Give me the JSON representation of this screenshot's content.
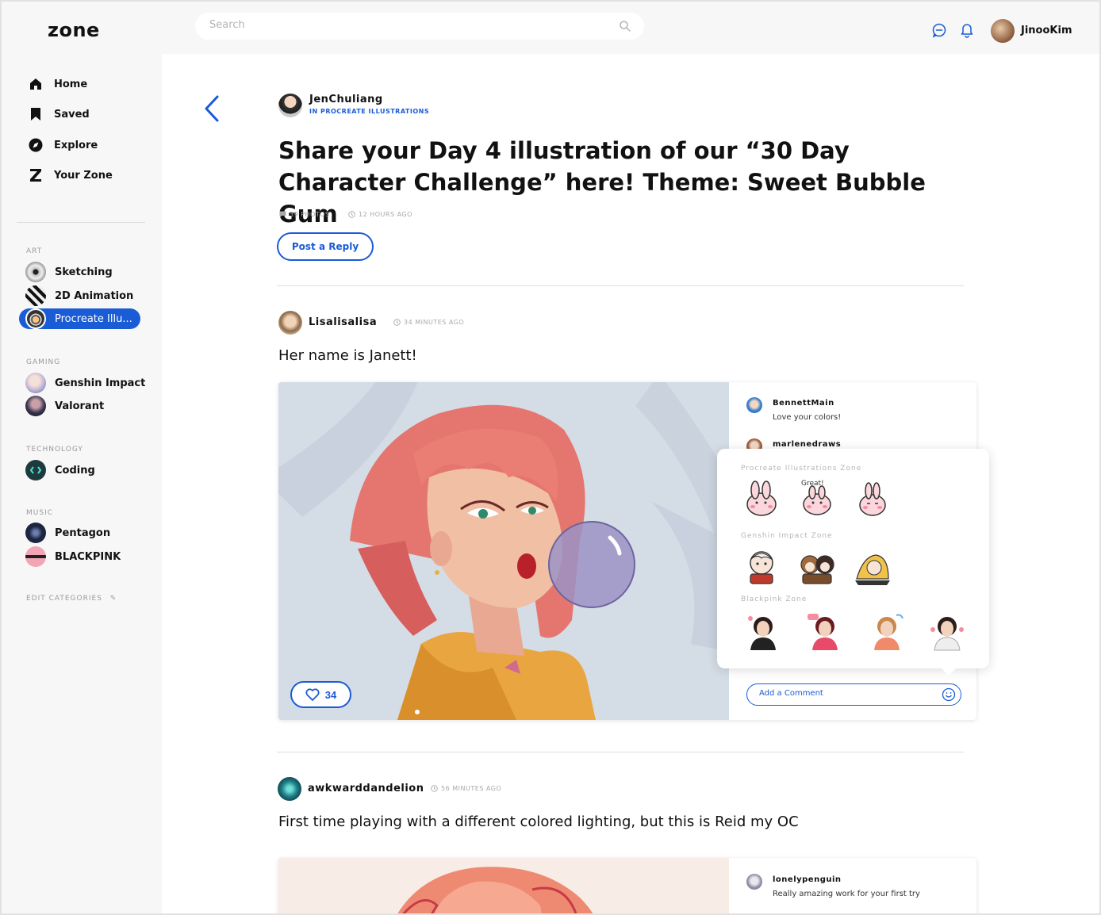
{
  "app": {
    "logo": "zone"
  },
  "search": {
    "placeholder": "Search"
  },
  "user": {
    "name": "JinooKim"
  },
  "nav": [
    {
      "label": "Home",
      "icon": "home-icon"
    },
    {
      "label": "Saved",
      "icon": "bookmark-icon"
    },
    {
      "label": "Explore",
      "icon": "compass-icon"
    },
    {
      "label": "Your Zone",
      "icon": "zone-icon"
    }
  ],
  "categories": {
    "art": {
      "heading": "ART",
      "items": [
        "Sketching",
        "2D Animation",
        "Procreate Illu..."
      ]
    },
    "gaming": {
      "heading": "GAMING",
      "items": [
        "Genshin Impact",
        "Valorant"
      ]
    },
    "technology": {
      "heading": "TECHNOLOGY",
      "items": [
        "Coding"
      ]
    },
    "music": {
      "heading": "MUSIC",
      "items": [
        "Pentagon",
        "BLACKPINK"
      ]
    },
    "edit_label": "EDIT CATEGORIES"
  },
  "post": {
    "author": "JenChuliang",
    "zone": "IN PROCREATE ILLUSTRATIONS",
    "title": "Share your Day 4 illustration of our “30 Day Character Challenge” here! Theme: Sweet Bubble Gum",
    "photos": "39 PHOTOS",
    "time": "12 HOURS AGO",
    "reply_label": "Post a Reply"
  },
  "replies": [
    {
      "author": "Lisalisalisa",
      "time": "34 MINUTES AGO",
      "text": "Her name is Janett!",
      "likes": "34",
      "comments": [
        {
          "name": "BennettMain",
          "text": "Love your colors!"
        },
        {
          "name": "marlenedraws",
          "text": ""
        }
      ],
      "add_comment_placeholder": "Add a Comment"
    },
    {
      "author": "awkwarddandelion",
      "time": "56 MINUTES AGO",
      "text": "First time playing with a different colored lighting, but this is Reid my OC",
      "comments": [
        {
          "name": "lonelypenguin",
          "text": "Really amazing work for your first try"
        }
      ]
    }
  ],
  "sticker_picker": {
    "zones": [
      "Procreate Illustrations Zone",
      "Genshin Impact Zone",
      "Blackpink Zone"
    ],
    "sticker_text": "Great!"
  },
  "colors": {
    "accent": "#1a5bd6",
    "sidebar_bg": "#f7f7f7"
  }
}
